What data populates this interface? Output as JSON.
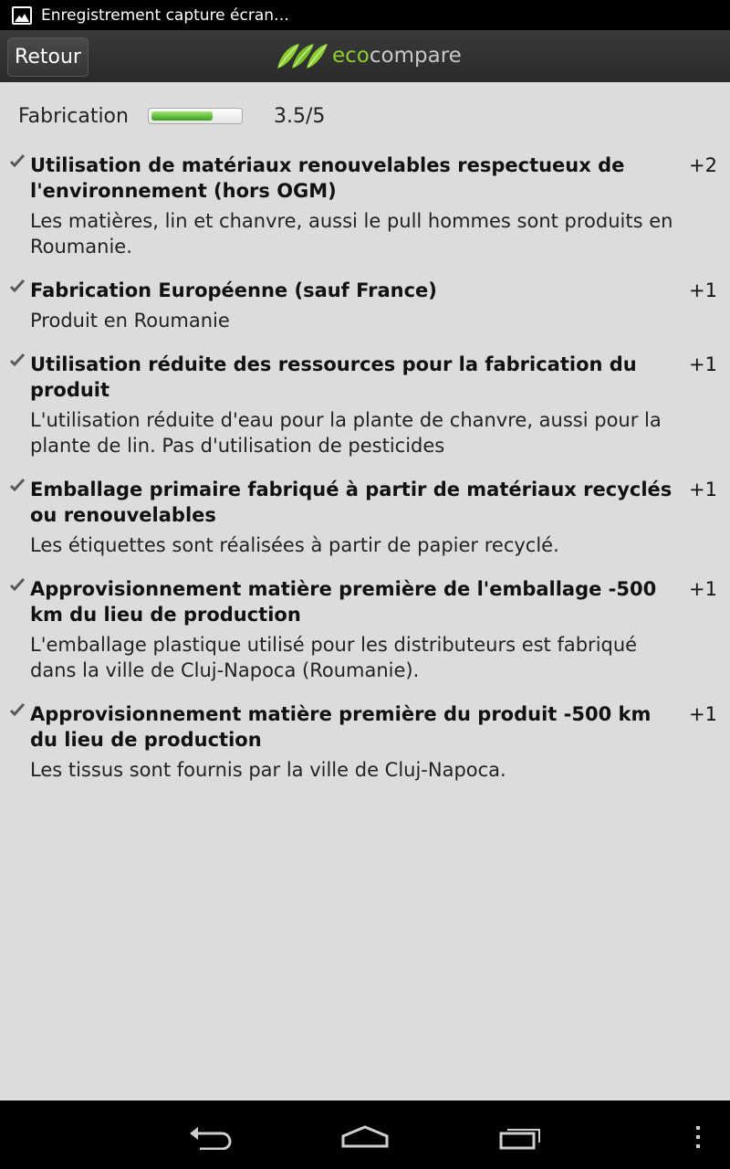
{
  "status_bar": {
    "notification_icon": "image-icon",
    "notification_text": "Enregistrement capture écran…"
  },
  "action_bar": {
    "back_label": "Retour",
    "logo_eco": "eco",
    "logo_compare": "compare"
  },
  "category": {
    "label": "Fabrication",
    "score_text": "3.5/5",
    "score_fraction": 0.7
  },
  "criteria": [
    {
      "title": "Utilisation de matériaux renouvelables respectueux de l'environnement (hors OGM)",
      "description": "Les matières, lin et chanvre, aussi le pull hommes sont produits en Roumanie.",
      "points": "+2"
    },
    {
      "title": "Fabrication Européenne (sauf France)",
      "description": "Produit en Roumanie",
      "points": "+1"
    },
    {
      "title": "Utilisation réduite des ressources pour la fabrication du produit",
      "description": "L'utilisation réduite d'eau pour la plante de chanvre, aussi pour la plante de lin. Pas d'utilisation de pesticides",
      "points": "+1"
    },
    {
      "title": "Emballage primaire fabriqué à partir de matériaux recyclés ou renouvelables",
      "description": "Les étiquettes sont réalisées à partir de papier recyclé.",
      "points": "+1"
    },
    {
      "title": "Approvisionnement matière première de l'emballage -500 km du lieu de production",
      "description": "L'emballage plastique utilisé pour les distributeurs est fabriqué dans la ville de Cluj-Napoca (Roumanie).",
      "points": "+1"
    },
    {
      "title": "Approvisionnement matière première du produit -500 km  du lieu de production",
      "description": "Les tissus sont fournis par la ville de Cluj-Napoca.",
      "points": "+1"
    }
  ],
  "nav_bar": {
    "back_icon": "back-arrow-icon",
    "home_icon": "home-icon",
    "recents_icon": "recent-apps-icon",
    "menu_icon": "overflow-menu-icon"
  },
  "colors": {
    "accent_green": "#8ccf2e",
    "background": "#dcdcdc",
    "bar_dark": "#2a2a2a"
  }
}
